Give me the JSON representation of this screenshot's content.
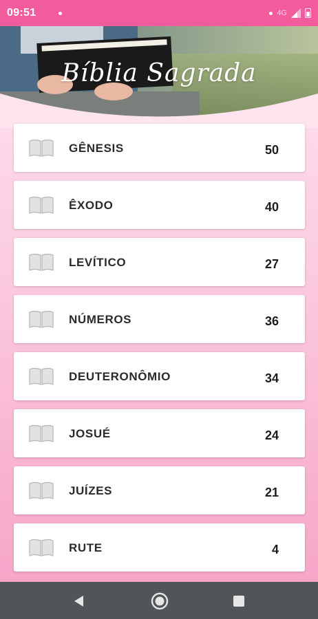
{
  "status_bar": {
    "time": "09:51",
    "network": "4G",
    "icons": [
      "notification-dot-icon",
      "signal-icon",
      "battery-icon"
    ]
  },
  "header": {
    "title": "Bíblia Sagrada",
    "background": "photo-person-reading-bible"
  },
  "books": [
    {
      "name": "GÊNESIS",
      "chapters": "50"
    },
    {
      "name": "ÊXODO",
      "chapters": "40"
    },
    {
      "name": "LEVÍTICO",
      "chapters": "27"
    },
    {
      "name": "NÚMEROS",
      "chapters": "36"
    },
    {
      "name": "DEUTERONÔMIO",
      "chapters": "34"
    },
    {
      "name": "JOSUÉ",
      "chapters": "24"
    },
    {
      "name": "JUÍZES",
      "chapters": "21"
    },
    {
      "name": "RUTE",
      "chapters": "4"
    }
  ],
  "nav": {
    "icons": [
      "back-icon",
      "home-icon",
      "recents-icon"
    ]
  },
  "colors": {
    "accent": "#f25b9c",
    "nav_bar": "#505557",
    "gradient_top": "#fde4ef",
    "gradient_bottom": "#f7a6c8"
  }
}
